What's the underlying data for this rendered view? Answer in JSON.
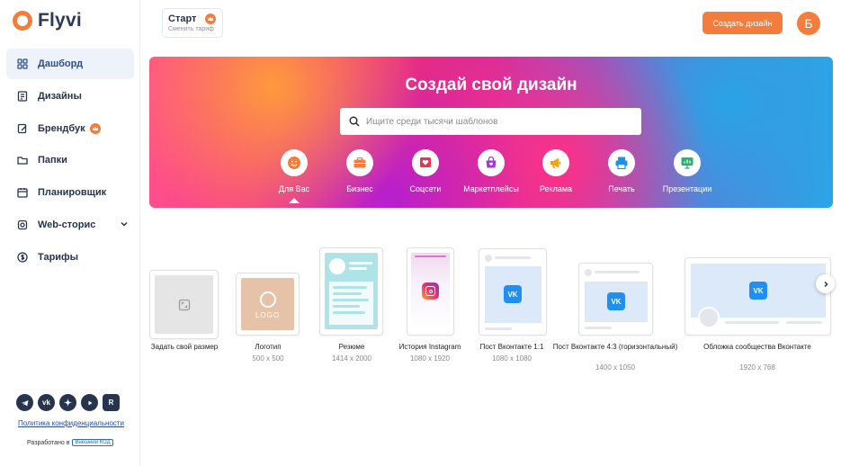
{
  "app": {
    "logo_text": "Flyvi"
  },
  "colors": {
    "accent": "#f37d3c",
    "navy": "#26344d",
    "active_bg": "#eef3fb",
    "vk": "#1f8ff0"
  },
  "header": {
    "plan_title": "Старт",
    "plan_sub": "Сменить тариф",
    "create_button": "Создать дизайн",
    "avatar_letter": "Б"
  },
  "sidebar": {
    "items": [
      {
        "label": "Дашборд",
        "icon": "dashboard-icon",
        "active": true
      },
      {
        "label": "Дизайны",
        "icon": "designs-icon"
      },
      {
        "label": "Брендбук",
        "icon": "brandbook-icon",
        "badge": "crown-icon"
      },
      {
        "label": "Папки",
        "icon": "folder-icon"
      },
      {
        "label": "Планировщик",
        "icon": "calendar-icon"
      },
      {
        "label": "Web-сторис",
        "icon": "web-stories-icon",
        "expandable": true
      },
      {
        "label": "Тарифы",
        "icon": "tariff-icon"
      }
    ],
    "socials": [
      "telegram-icon",
      "vk-icon",
      "dzen-icon",
      "youtube-icon",
      "rutube-icon"
    ],
    "privacy": "Политика конфиденциальности",
    "made_by": "Разработано в",
    "made_by_logo": "Внешний КОД"
  },
  "hero": {
    "title": "Создай свой дизайн",
    "search_placeholder": "Ищите среди тысячи шаблонов",
    "categories": [
      {
        "label": "Для Вас",
        "icon": "smile-icon",
        "color": "#f37d3c",
        "selected": true
      },
      {
        "label": "Бизнес",
        "icon": "briefcase-icon",
        "color": "#f37d3c"
      },
      {
        "label": "Соцсети",
        "icon": "heart-icon",
        "color": "#e8344e"
      },
      {
        "label": "Маркетплейсы",
        "icon": "shopping-bag-icon",
        "color": "#9b3bd0"
      },
      {
        "label": "Реклама",
        "icon": "megaphone-icon",
        "color": "#f2a31b"
      },
      {
        "label": "Печать",
        "icon": "printer-icon",
        "color": "#1f8ff0"
      },
      {
        "label": "Презентации",
        "icon": "presentation-icon",
        "color": "#2bb36b"
      }
    ]
  },
  "templates": [
    {
      "name": "Задать свой размер",
      "size": ""
    },
    {
      "name": "Логотип",
      "size": "500 x 500",
      "logo_text": "LOGO"
    },
    {
      "name": "Резюме",
      "size": "1414 x 2000"
    },
    {
      "name": "История Instagram",
      "size": "1080 x 1920"
    },
    {
      "name": "Пост Вконтакте 1:1",
      "size": "1080 x 1080"
    },
    {
      "name": "Пост Вконтакте 4:3 (горизонтальный)",
      "size": "1400 x 1050"
    },
    {
      "name": "Обложка сообщества Вконтакте",
      "size": "1920 x 768"
    }
  ]
}
